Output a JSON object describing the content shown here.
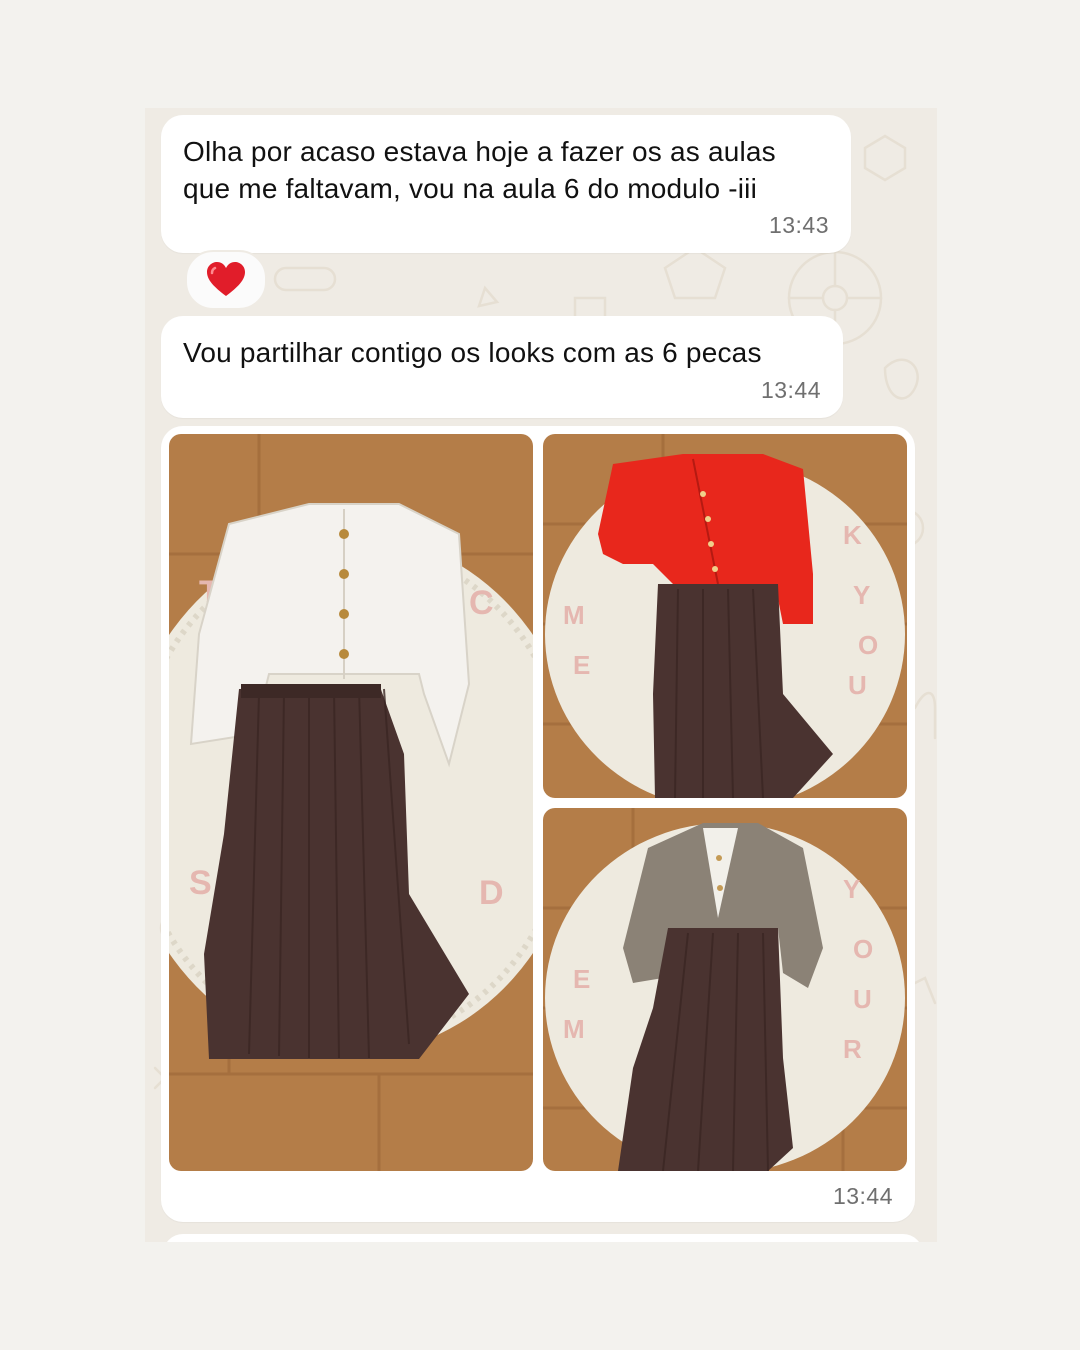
{
  "messages": [
    {
      "text": "Olha por acaso estava hoje a fazer os as aulas que me faltavam, vou na aula 6 do modulo -iii",
      "time": "13:43",
      "reaction": "heart"
    },
    {
      "text": "Vou partilhar contigo os looks com as 6 pecas",
      "time": "13:44"
    },
    {
      "type": "photo-album",
      "time": "13:44",
      "photos": [
        {
          "label": "white blouse with brown pleated skirt"
        },
        {
          "label": "red cardigan with brown pleated skirt"
        },
        {
          "label": "grey blazer with white blouse and brown pleated skirt"
        }
      ]
    }
  ],
  "icons": {
    "reaction": "red-heart-icon"
  },
  "colors": {
    "chat_background": "#efebe4",
    "bubble": "#ffffff",
    "time": "#6f6f6f",
    "heart": "#e11d2a"
  }
}
